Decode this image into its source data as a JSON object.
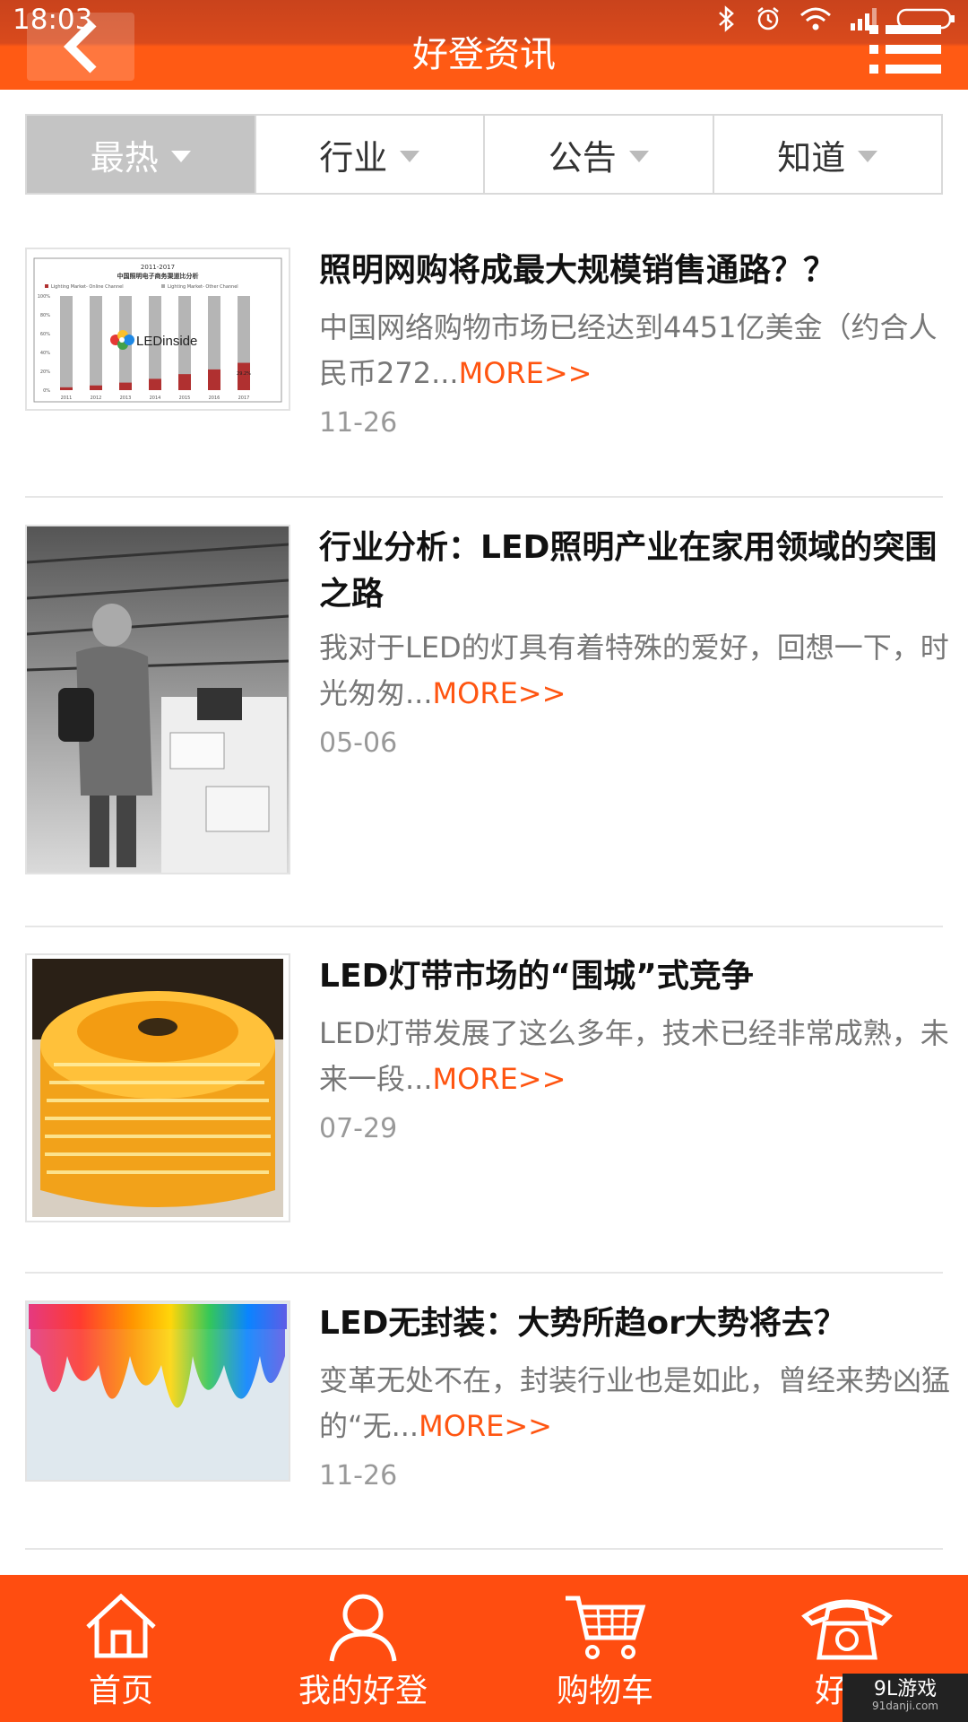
{
  "status_bar": {
    "time": "18:03"
  },
  "header": {
    "title": "好登资讯"
  },
  "filters": [
    {
      "label": "最热",
      "active": true
    },
    {
      "label": "行业",
      "active": false
    },
    {
      "label": "公告",
      "active": false
    },
    {
      "label": "知道",
      "active": false
    }
  ],
  "news": [
    {
      "title": "照明网购将成最大规模销售通路？？",
      "summary": "中国网络购物市场已经达到4451亿美金（约合人民币272...",
      "more": "MORE>>",
      "date": "11-26",
      "thumb": {
        "chart_title": "2011-2017",
        "chart_subtitle": "中国照明电子商务渠道比分析",
        "logo": "LEDinside",
        "legend": [
          "Lighting Market- Online Channel",
          "Lighting Market- Other Channel"
        ],
        "years": [
          "2011",
          "2012",
          "2013",
          "2014",
          "2015",
          "2016",
          "2017"
        ],
        "yticks": [
          "100%",
          "80%",
          "60%",
          "40%",
          "20%",
          "0%"
        ],
        "label_2017": "29.2%"
      }
    },
    {
      "title": "行业分析：LED照明产业在家用领域的突围之路",
      "summary": "我对于LED的灯具有着特殊的爱好，回想一下，时光匆匆...",
      "more": "MORE>>",
      "date": "05-06"
    },
    {
      "title": "LED灯带市场的“围城”式竞争",
      "summary": "LED灯带发展了这么多年，技术已经非常成熟，未来一段...",
      "more": "MORE>>",
      "date": "07-29"
    },
    {
      "title": "LED无封装：大势所趋or大势将去？",
      "summary": "变革无处不在，封装行业也是如此，曾经来势凶猛的“无...",
      "more": "MORE>>",
      "date": "11-26"
    }
  ],
  "bottom_nav": [
    {
      "label": "首页",
      "icon": "home-icon"
    },
    {
      "label": "我的好登",
      "icon": "user-icon"
    },
    {
      "label": "购物车",
      "icon": "cart-icon"
    },
    {
      "label": "好登",
      "icon": "phone-icon"
    }
  ],
  "watermark": {
    "text": "9L游戏",
    "sub": "91danji.com"
  },
  "colors": {
    "accent": "#ff4d10",
    "more": "#ff5511",
    "active_tab": "#c4c4c4"
  }
}
